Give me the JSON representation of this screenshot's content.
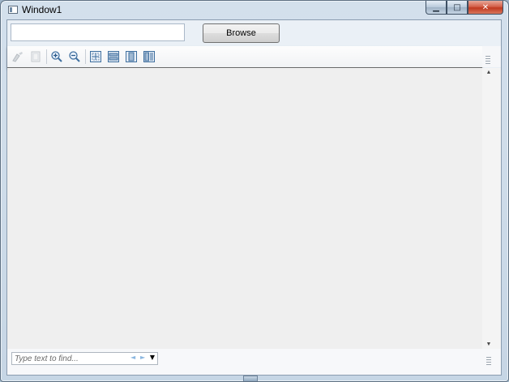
{
  "window": {
    "title": "Window1",
    "caption_buttons": {
      "minimize": "▁",
      "maximize": "□",
      "close": "✕"
    }
  },
  "toolbar": {
    "path_value": "",
    "browse_label": "Browse"
  },
  "viewer_toolbar": {
    "icons": [
      "copy-icon",
      "page-icon",
      "zoom-in-icon",
      "zoom-out-icon",
      "actual-size-icon",
      "page-width-icon",
      "whole-page-icon",
      "two-pages-icon"
    ]
  },
  "find": {
    "placeholder": "Type text to find...",
    "prev_glyph": "◄",
    "next_glyph": "►",
    "dropdown_glyph": "▼"
  },
  "scrollbar": {
    "up_glyph": "▲",
    "down_glyph": "▼"
  },
  "colors": {
    "frame": "#5c6f82",
    "client": "#eaf0f6",
    "document": "#efefef",
    "icon_blue": "#3f6f9f",
    "close_red": "#c0391f"
  }
}
